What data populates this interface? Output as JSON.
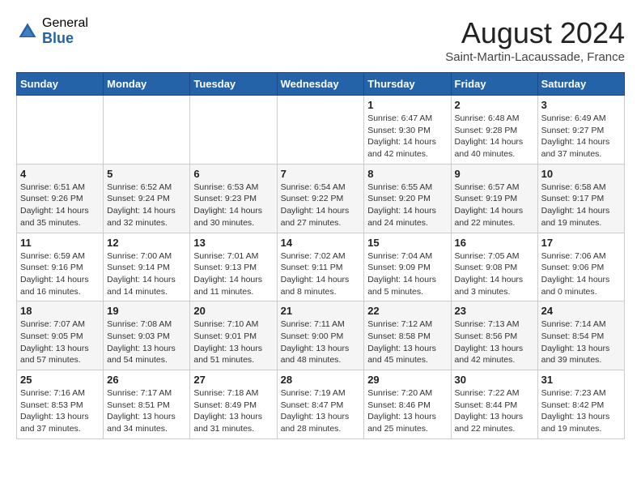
{
  "header": {
    "logo_general": "General",
    "logo_blue": "Blue",
    "title": "August 2024",
    "location": "Saint-Martin-Lacaussade, France"
  },
  "weekdays": [
    "Sunday",
    "Monday",
    "Tuesday",
    "Wednesday",
    "Thursday",
    "Friday",
    "Saturday"
  ],
  "weeks": [
    [
      {
        "day": "",
        "info": ""
      },
      {
        "day": "",
        "info": ""
      },
      {
        "day": "",
        "info": ""
      },
      {
        "day": "",
        "info": ""
      },
      {
        "day": "1",
        "info": "Sunrise: 6:47 AM\nSunset: 9:30 PM\nDaylight: 14 hours and 42 minutes."
      },
      {
        "day": "2",
        "info": "Sunrise: 6:48 AM\nSunset: 9:28 PM\nDaylight: 14 hours and 40 minutes."
      },
      {
        "day": "3",
        "info": "Sunrise: 6:49 AM\nSunset: 9:27 PM\nDaylight: 14 hours and 37 minutes."
      }
    ],
    [
      {
        "day": "4",
        "info": "Sunrise: 6:51 AM\nSunset: 9:26 PM\nDaylight: 14 hours and 35 minutes."
      },
      {
        "day": "5",
        "info": "Sunrise: 6:52 AM\nSunset: 9:24 PM\nDaylight: 14 hours and 32 minutes."
      },
      {
        "day": "6",
        "info": "Sunrise: 6:53 AM\nSunset: 9:23 PM\nDaylight: 14 hours and 30 minutes."
      },
      {
        "day": "7",
        "info": "Sunrise: 6:54 AM\nSunset: 9:22 PM\nDaylight: 14 hours and 27 minutes."
      },
      {
        "day": "8",
        "info": "Sunrise: 6:55 AM\nSunset: 9:20 PM\nDaylight: 14 hours and 24 minutes."
      },
      {
        "day": "9",
        "info": "Sunrise: 6:57 AM\nSunset: 9:19 PM\nDaylight: 14 hours and 22 minutes."
      },
      {
        "day": "10",
        "info": "Sunrise: 6:58 AM\nSunset: 9:17 PM\nDaylight: 14 hours and 19 minutes."
      }
    ],
    [
      {
        "day": "11",
        "info": "Sunrise: 6:59 AM\nSunset: 9:16 PM\nDaylight: 14 hours and 16 minutes."
      },
      {
        "day": "12",
        "info": "Sunrise: 7:00 AM\nSunset: 9:14 PM\nDaylight: 14 hours and 14 minutes."
      },
      {
        "day": "13",
        "info": "Sunrise: 7:01 AM\nSunset: 9:13 PM\nDaylight: 14 hours and 11 minutes."
      },
      {
        "day": "14",
        "info": "Sunrise: 7:02 AM\nSunset: 9:11 PM\nDaylight: 14 hours and 8 minutes."
      },
      {
        "day": "15",
        "info": "Sunrise: 7:04 AM\nSunset: 9:09 PM\nDaylight: 14 hours and 5 minutes."
      },
      {
        "day": "16",
        "info": "Sunrise: 7:05 AM\nSunset: 9:08 PM\nDaylight: 14 hours and 3 minutes."
      },
      {
        "day": "17",
        "info": "Sunrise: 7:06 AM\nSunset: 9:06 PM\nDaylight: 14 hours and 0 minutes."
      }
    ],
    [
      {
        "day": "18",
        "info": "Sunrise: 7:07 AM\nSunset: 9:05 PM\nDaylight: 13 hours and 57 minutes."
      },
      {
        "day": "19",
        "info": "Sunrise: 7:08 AM\nSunset: 9:03 PM\nDaylight: 13 hours and 54 minutes."
      },
      {
        "day": "20",
        "info": "Sunrise: 7:10 AM\nSunset: 9:01 PM\nDaylight: 13 hours and 51 minutes."
      },
      {
        "day": "21",
        "info": "Sunrise: 7:11 AM\nSunset: 9:00 PM\nDaylight: 13 hours and 48 minutes."
      },
      {
        "day": "22",
        "info": "Sunrise: 7:12 AM\nSunset: 8:58 PM\nDaylight: 13 hours and 45 minutes."
      },
      {
        "day": "23",
        "info": "Sunrise: 7:13 AM\nSunset: 8:56 PM\nDaylight: 13 hours and 42 minutes."
      },
      {
        "day": "24",
        "info": "Sunrise: 7:14 AM\nSunset: 8:54 PM\nDaylight: 13 hours and 39 minutes."
      }
    ],
    [
      {
        "day": "25",
        "info": "Sunrise: 7:16 AM\nSunset: 8:53 PM\nDaylight: 13 hours and 37 minutes."
      },
      {
        "day": "26",
        "info": "Sunrise: 7:17 AM\nSunset: 8:51 PM\nDaylight: 13 hours and 34 minutes."
      },
      {
        "day": "27",
        "info": "Sunrise: 7:18 AM\nSunset: 8:49 PM\nDaylight: 13 hours and 31 minutes."
      },
      {
        "day": "28",
        "info": "Sunrise: 7:19 AM\nSunset: 8:47 PM\nDaylight: 13 hours and 28 minutes."
      },
      {
        "day": "29",
        "info": "Sunrise: 7:20 AM\nSunset: 8:46 PM\nDaylight: 13 hours and 25 minutes."
      },
      {
        "day": "30",
        "info": "Sunrise: 7:22 AM\nSunset: 8:44 PM\nDaylight: 13 hours and 22 minutes."
      },
      {
        "day": "31",
        "info": "Sunrise: 7:23 AM\nSunset: 8:42 PM\nDaylight: 13 hours and 19 minutes."
      }
    ]
  ]
}
